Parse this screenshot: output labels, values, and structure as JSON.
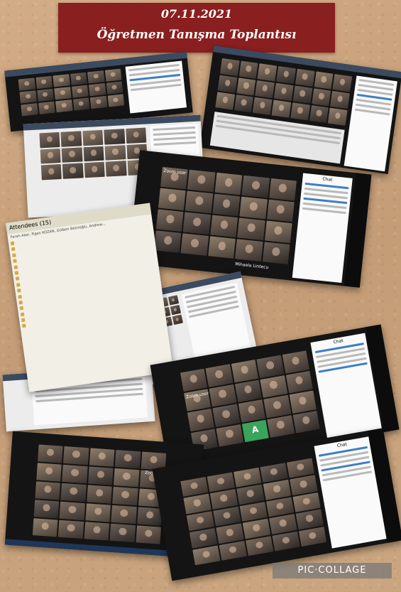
{
  "banner": {
    "date": "07.11.2021",
    "title": "Öğretmen Tanışma Toplantısı"
  },
  "attendees_panel": {
    "header": "Attendees (15)",
    "presenter": "Ferah Aker, Figen KOZAN, Gülben Bekiroğlu, Andrew..."
  },
  "zoom": {
    "label_1": "Zoom user",
    "label_2": "Zoom user",
    "label_3": "Zoom user",
    "label_4": "Mihaela Lintecu",
    "avatar_letter": "A",
    "chat_title": "Chat"
  },
  "watermark": "PIC·COLLAGE",
  "colors": {
    "background": "#c9a27c",
    "banner": "#8a1f1f",
    "zoom_dark": "#141414",
    "accent_green": "#3aa45a"
  }
}
